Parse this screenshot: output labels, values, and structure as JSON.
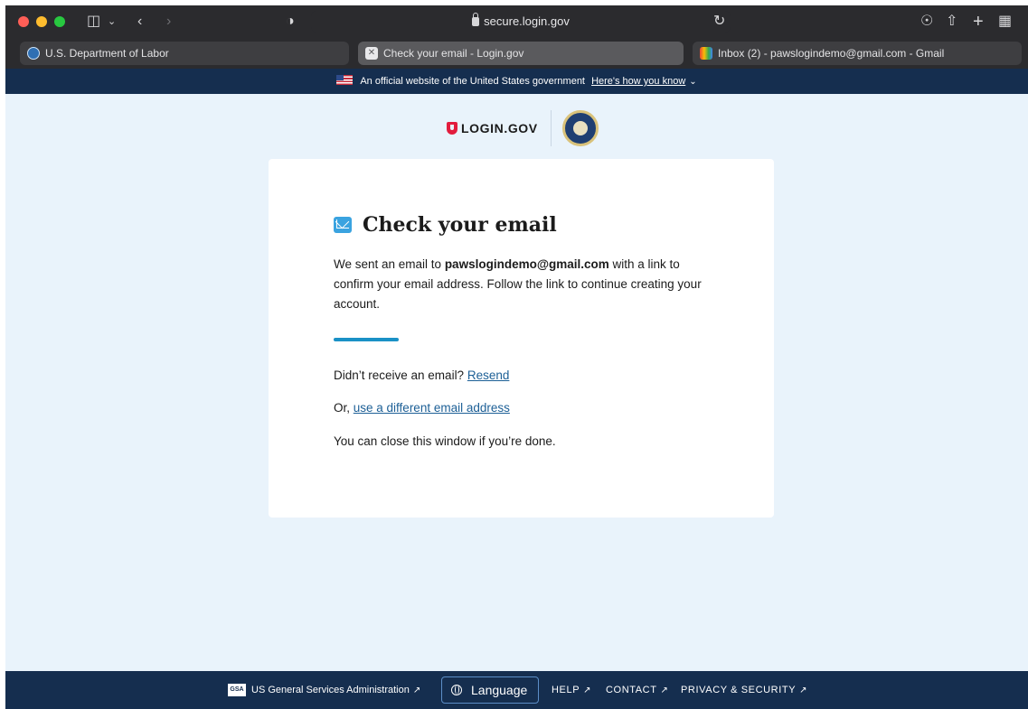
{
  "browser": {
    "url": "secure.login.gov",
    "tabs": [
      {
        "label": "U.S. Department of Labor",
        "favicon": "dol-seal-icon"
      },
      {
        "label": "Check your email - Login.gov",
        "favicon": "login-gov-icon",
        "active": true
      },
      {
        "label": "Inbox (2) - pawslogindemo@gmail.com - Gmail",
        "favicon": "gmail-icon"
      }
    ]
  },
  "gov_banner": {
    "text": "An official website of the United States government",
    "link": "Here's how you know"
  },
  "header": {
    "logo_text": "LOGIN.GOV"
  },
  "card": {
    "title": "Check your email",
    "body_prefix": "We sent an email to ",
    "email": "pawslogindemo@gmail.com",
    "body_suffix": " with a link to confirm your email address. Follow the link to continue creating your account.",
    "resend_prompt": "Didn’t receive an email?",
    "resend_link": "Resend",
    "alt_prefix": "Or, ",
    "alt_link": "use a different email address",
    "close_text": "You can close this window if you’re done."
  },
  "footer": {
    "gsa_badge": "GSA",
    "gsa_label": "US General Services Administration",
    "language_label": "Language",
    "help": "HELP",
    "contact": "CONTACT",
    "privacy": "PRIVACY & SECURITY"
  },
  "colors": {
    "banner_bg": "#152e4f",
    "page_bg": "#e9f3fb",
    "brand_red": "#e21c3d",
    "accent_blue": "#1a91c6",
    "link": "#1c5f96"
  }
}
